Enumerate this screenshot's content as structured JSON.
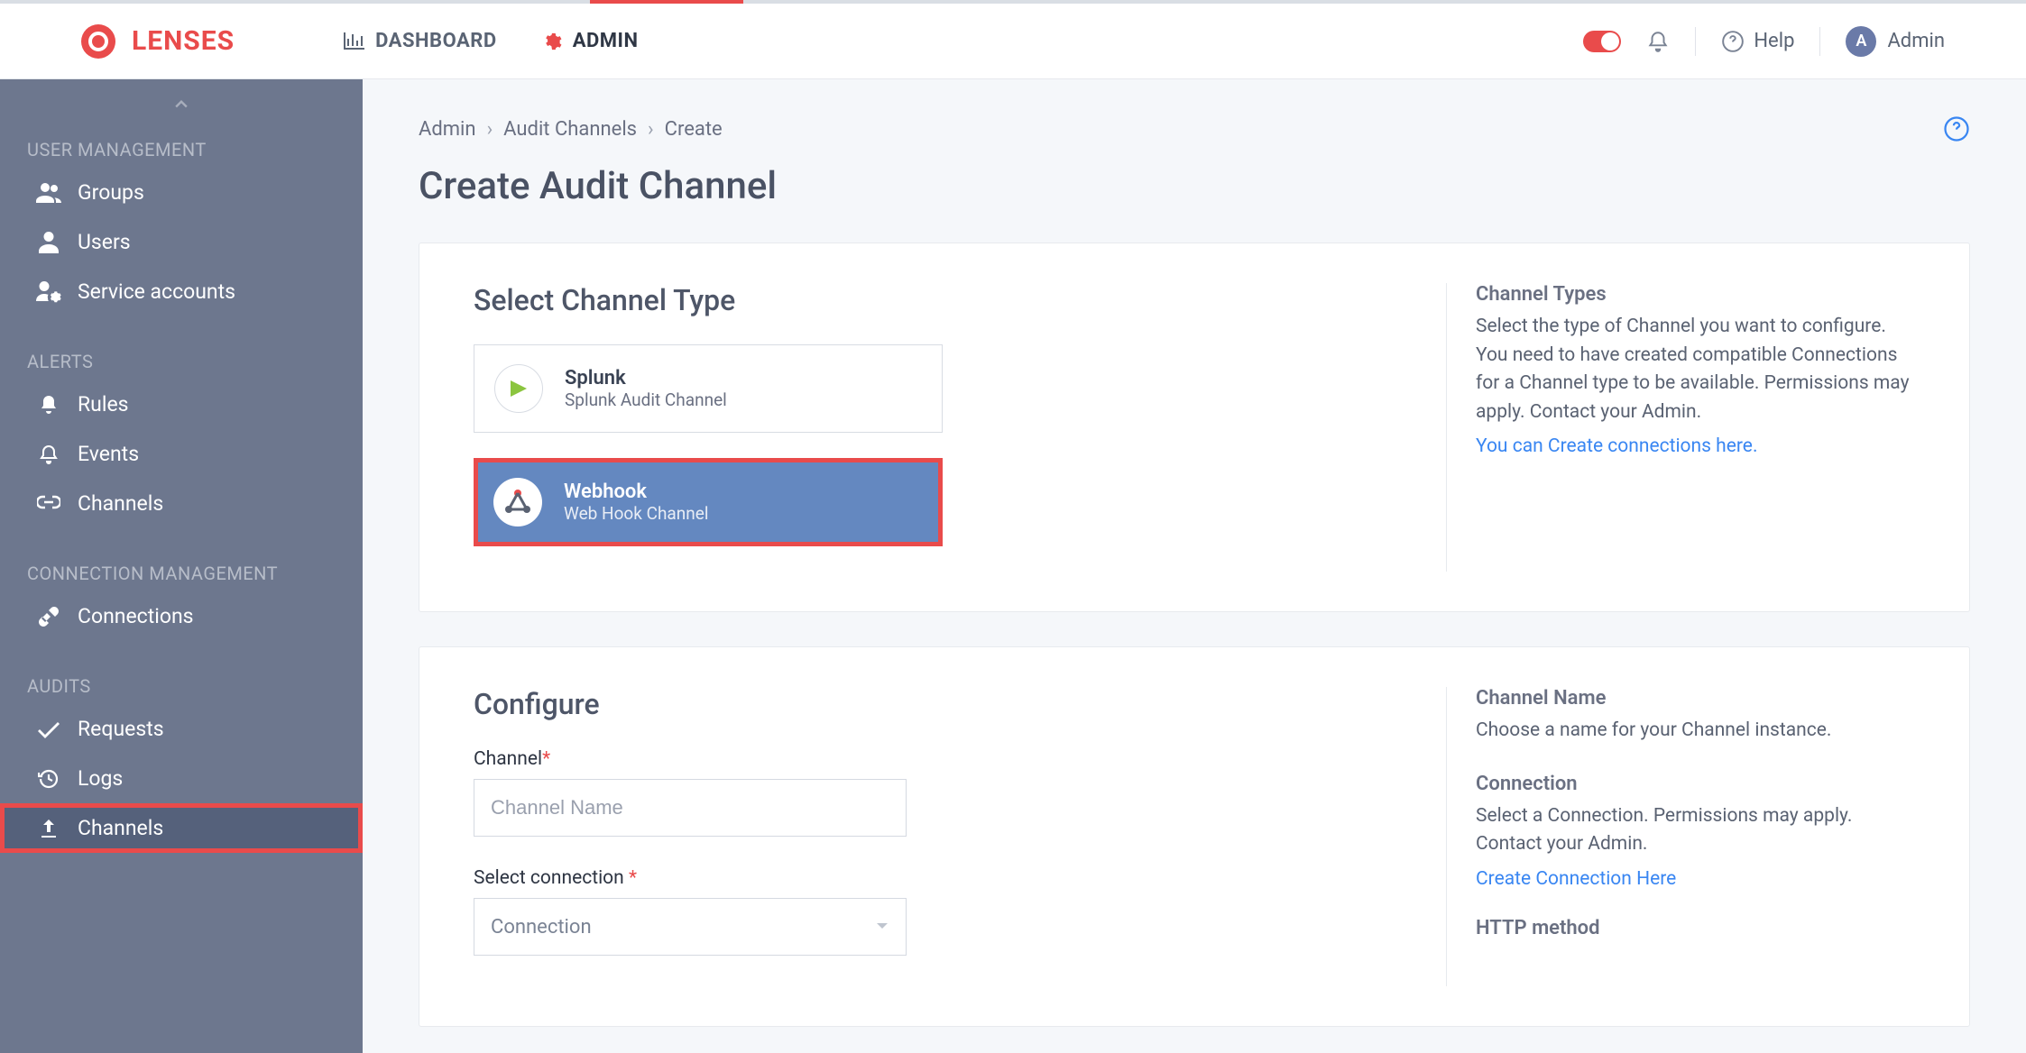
{
  "brand": {
    "name": "LENSES"
  },
  "top_nav": {
    "dashboard": "DASHBOARD",
    "admin": "ADMIN",
    "help": "Help",
    "user": "Admin",
    "avatar_initial": "A"
  },
  "sidebar": {
    "sections": [
      {
        "title": "USER MANAGEMENT",
        "items": [
          {
            "label": "Groups",
            "icon": "users-icon"
          },
          {
            "label": "Users",
            "icon": "user-icon"
          },
          {
            "label": "Service accounts",
            "icon": "user-cog-icon"
          }
        ]
      },
      {
        "title": "ALERTS",
        "items": [
          {
            "label": "Rules",
            "icon": "bell-solid-icon"
          },
          {
            "label": "Events",
            "icon": "bell-icon"
          },
          {
            "label": "Channels",
            "icon": "link-icon"
          }
        ]
      },
      {
        "title": "CONNECTION MANAGEMENT",
        "items": [
          {
            "label": "Connections",
            "icon": "plug-icon"
          }
        ]
      },
      {
        "title": "AUDITS",
        "items": [
          {
            "label": "Requests",
            "icon": "check-icon"
          },
          {
            "label": "Logs",
            "icon": "history-icon"
          },
          {
            "label": "Channels",
            "icon": "upload-icon",
            "active": true
          }
        ]
      }
    ]
  },
  "breadcrumbs": {
    "a": "Admin",
    "b": "Audit Channels",
    "c": "Create"
  },
  "page": {
    "title": "Create Audit Channel"
  },
  "select_type": {
    "heading": "Select Channel Type",
    "types": [
      {
        "title": "Splunk",
        "sub": "Splunk Audit Channel",
        "selected": false
      },
      {
        "title": "Webhook",
        "sub": "Web Hook Channel",
        "selected": true
      }
    ],
    "help": {
      "title": "Channel Types",
      "body": "Select the type of Channel you want to configure. You need to have created compatible Connections for a Channel type to be available. Permissions may apply. Contact your Admin.",
      "link": "You can Create connections here."
    }
  },
  "configure": {
    "heading": "Configure",
    "channel_label": "Channel",
    "channel_placeholder": "Channel Name",
    "connection_label": "Select connection",
    "connection_placeholder": "Connection",
    "help": {
      "name_title": "Channel Name",
      "name_body": "Choose a name for your Channel instance.",
      "conn_title": "Connection",
      "conn_body": "Select a Connection. Permissions may apply. Contact your Admin.",
      "conn_link": "Create Connection Here",
      "http_title": "HTTP method"
    }
  }
}
